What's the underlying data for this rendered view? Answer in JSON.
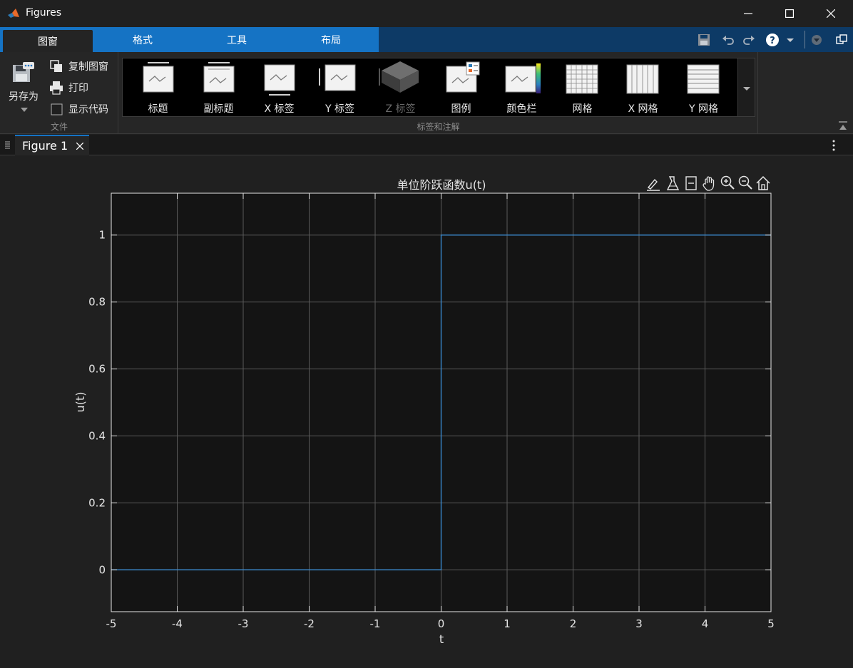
{
  "window": {
    "title": "Figures",
    "minimize_icon": "minimize-icon",
    "maximize_icon": "maximize-icon",
    "close_icon": "close-icon"
  },
  "ribbon_tabs": [
    {
      "label": "图窗",
      "active": true
    },
    {
      "label": "格式",
      "active": false
    },
    {
      "label": "工具",
      "active": false
    },
    {
      "label": "布局",
      "active": false
    }
  ],
  "quick_access": [
    "save-icon",
    "undo-icon",
    "redo-icon",
    "help-icon",
    "dropdown-icon",
    "collapse-ribbon-icon",
    "undock-icon"
  ],
  "file_group": {
    "saveas_label": "另存为",
    "copy_label": "复制图窗",
    "print_label": "打印",
    "show_code_label": "显示代码",
    "show_code_checked": false,
    "group_label": "文件"
  },
  "annotation_group": {
    "group_label": "标签和注解",
    "items": [
      {
        "label": "标题",
        "icon": "title-icon",
        "disabled": false
      },
      {
        "label": "副标题",
        "icon": "subtitle-icon",
        "disabled": false
      },
      {
        "label": "X 标签",
        "icon": "xlabel-icon",
        "disabled": false
      },
      {
        "label": "Y 标签",
        "icon": "ylabel-icon",
        "disabled": false
      },
      {
        "label": "Z 标签",
        "icon": "zlabel-icon",
        "disabled": true
      },
      {
        "label": "图例",
        "icon": "legend-icon",
        "disabled": false
      },
      {
        "label": "颜色栏",
        "icon": "colorbar-icon",
        "disabled": false
      },
      {
        "label": "网格",
        "icon": "grid-icon",
        "disabled": false
      },
      {
        "label": "X 网格",
        "icon": "xgrid-icon",
        "disabled": false
      },
      {
        "label": "Y 网格",
        "icon": "ygrid-icon",
        "disabled": false
      }
    ]
  },
  "figure_tab": {
    "label": "Figure 1"
  },
  "axes_toolbar": [
    "brush-icon",
    "datatip-icon",
    "linked-icon",
    "pan-icon",
    "zoom-in-icon",
    "zoom-out-icon",
    "home-icon"
  ],
  "colors": {
    "line": "#3a8fd8",
    "axes_bg": "#141414",
    "figure_bg": "#202020",
    "accent": "#1573c4"
  },
  "chart_data": {
    "type": "line",
    "title": "单位阶跃函数u(t)",
    "xlabel": "t",
    "ylabel": "u(t)",
    "xlim": [
      -5,
      5
    ],
    "ylim": [
      -0.125,
      1.125
    ],
    "xticks": [
      -5,
      -4,
      -3,
      -2,
      -1,
      0,
      1,
      2,
      3,
      4,
      5
    ],
    "yticks": [
      0,
      0.2,
      0.4,
      0.6,
      0.8,
      1
    ],
    "grid": true,
    "series": [
      {
        "x": [
          -5,
          0,
          0,
          5
        ],
        "y": [
          0,
          0,
          1,
          1
        ]
      }
    ]
  }
}
